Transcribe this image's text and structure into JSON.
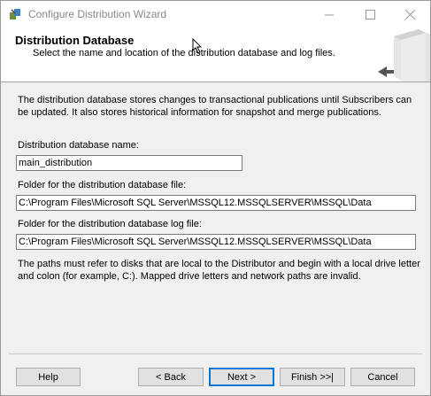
{
  "window": {
    "title": "Configure Distribution Wizard",
    "controls": {
      "minimize": "—",
      "maximize": "☐",
      "close": "✕"
    }
  },
  "header": {
    "title": "Distribution Database",
    "subtitle": "Select the name and location of the distribution database and log files."
  },
  "body": {
    "description": "The distribution database stores changes to transactional publications until Subscribers can be updated. It also stores historical information for snapshot and merge publications.",
    "db_name_label": "Distribution database name:",
    "db_name_value": "main_distribution",
    "db_folder_label": "Folder for the distribution database file:",
    "db_folder_value": "C:\\Program Files\\Microsoft SQL Server\\MSSQL12.MSSQLSERVER\\MSSQL\\Data",
    "log_folder_label": "Folder for the distribution database log file:",
    "log_folder_value": "C:\\Program Files\\Microsoft SQL Server\\MSSQL12.MSSQLSERVER\\MSSQL\\Data",
    "note": "The paths must refer to disks that are local to the Distributor and begin with a local drive letter and colon (for example, C:). Mapped drive letters and network paths are invalid."
  },
  "buttons": {
    "help": "Help",
    "back": "< Back",
    "next": "Next >",
    "finish": "Finish >>|",
    "cancel": "Cancel"
  },
  "icons": {
    "app": "wizard-icon",
    "header_graphic": "server-graphic-icon",
    "cursor": "mouse-cursor-icon"
  },
  "colors": {
    "accent": "#0078d7",
    "window_bg": "#f0f0f0",
    "header_bg": "#ffffff"
  }
}
